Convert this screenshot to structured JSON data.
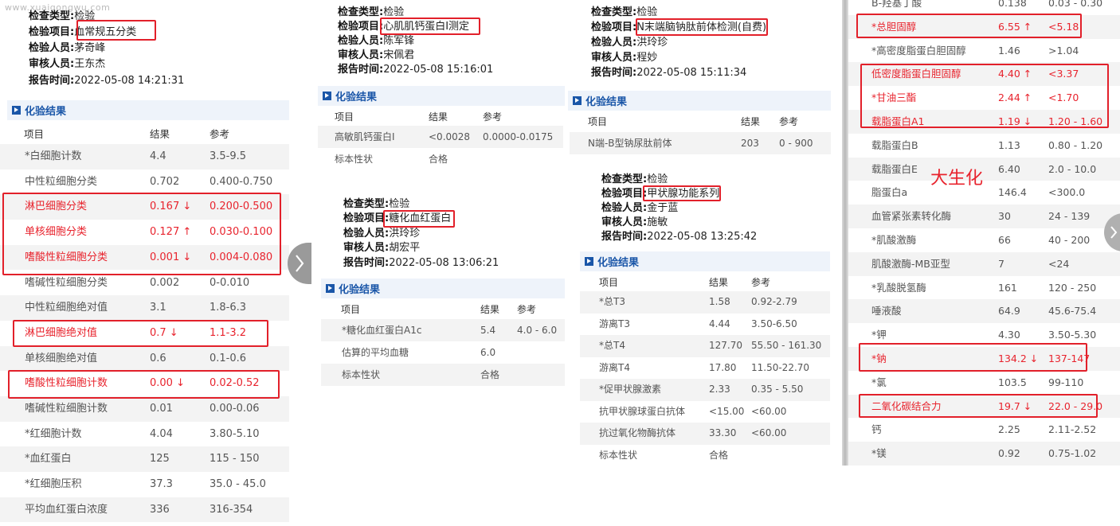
{
  "watermark": "www.xuaigongwu.com",
  "labels": {
    "type": "检查类型:",
    "item": "检验项目:",
    "person": "检验人员:",
    "reviewer": "审核人员:",
    "time": "报告时间:"
  },
  "section_title": "化验结果",
  "col": {
    "item": "项目",
    "result": "结果",
    "ref": "参考"
  },
  "p1": {
    "type": "检验",
    "item": "血常规五分类",
    "person": "茅奇峰",
    "reviewer": "王东杰",
    "time": "2022-05-08 14:21:31",
    "rows": [
      [
        "*白细胞计数",
        "4.4",
        "3.5-9.5"
      ],
      [
        "中性粒细胞分类",
        "0.702",
        "0.400-0.750"
      ],
      [
        "淋巴细胞分类",
        "0.167 ↓",
        "0.200-0.500"
      ],
      [
        "单核细胞分类",
        "0.127 ↑",
        "0.030-0.100"
      ],
      [
        "嗜酸性粒细胞分类",
        "0.001 ↓",
        "0.004-0.080"
      ],
      [
        "嗜碱性粒细胞分类",
        "0.002",
        "0-0.010"
      ],
      [
        "中性粒细胞绝对值",
        "3.1",
        "1.8-6.3"
      ],
      [
        "淋巴细胞绝对值",
        "0.7 ↓",
        "1.1-3.2"
      ],
      [
        "单核细胞绝对值",
        "0.6",
        "0.1-0.6"
      ],
      [
        "嗜酸性粒细胞计数",
        "0.00 ↓",
        "0.02-0.52"
      ],
      [
        "嗜碱性粒细胞计数",
        "0.01",
        "0.00-0.06"
      ],
      [
        "*红细胞计数",
        "4.04",
        "3.80-5.10"
      ],
      [
        "*血红蛋白",
        "125",
        "115 - 150"
      ],
      [
        "*红细胞压积",
        "37.3",
        "35.0 - 45.0"
      ],
      [
        "平均血红蛋白浓度",
        "336",
        "316-354"
      ]
    ]
  },
  "p2": {
    "type": "检验",
    "item": "心肌肌钙蛋白I测定",
    "person": "陈军锋",
    "reviewer": "宋佩君",
    "time": "2022-05-08 15:16:01",
    "rows": [
      [
        "高敏肌钙蛋白I",
        "<0.0028",
        "0.0000-0.0175"
      ],
      [
        "标本性状",
        "合格",
        ""
      ]
    ]
  },
  "p3": {
    "type": "检验",
    "item": "糖化血红蛋白",
    "person": "洪玲珍",
    "reviewer": "胡宏平",
    "time": "2022-05-08 13:06:21",
    "rows": [
      [
        "*糖化血红蛋白A1c",
        "5.4",
        "4.0 - 6.0"
      ],
      [
        "估算的平均血糖",
        "6.0",
        ""
      ],
      [
        "标本性状",
        "合格",
        ""
      ]
    ]
  },
  "p4": {
    "type": "检验",
    "item": "N末端脑钠肽前体检测(自费)",
    "person": "洪玲珍",
    "reviewer": "程妙",
    "time": "2022-05-08 15:11:34",
    "rows": [
      [
        "N端-B型钠尿肽前体",
        "203",
        "0 - 900"
      ]
    ]
  },
  "p5": {
    "type": "检验",
    "item": "甲状腺功能系列",
    "person": "金于蓝",
    "reviewer": "施敏",
    "time": "2022-05-08 13:25:42",
    "rows": [
      [
        "*总T3",
        "1.58",
        "0.92-2.79"
      ],
      [
        "游离T3",
        "4.44",
        "3.50-6.50"
      ],
      [
        "*总T4",
        "127.70",
        "55.50 - 161.30"
      ],
      [
        "游离T4",
        "17.80",
        "11.50-22.70"
      ],
      [
        "*促甲状腺激素",
        "2.33",
        "0.35 - 5.50"
      ],
      [
        "抗甲状腺球蛋白抗体",
        "<15.00",
        "<60.00"
      ],
      [
        "抗过氧化物酶抗体",
        "33.30",
        "<60.00"
      ],
      [
        "标本性状",
        "合格",
        ""
      ]
    ]
  },
  "p6": {
    "annotation": "大生化",
    "rows": [
      [
        "B-羟基丁酸",
        "0.138",
        "0.03 - 0.30"
      ],
      [
        "*总胆固醇",
        "6.55 ↑",
        "<5.18"
      ],
      [
        "*高密度脂蛋白胆固醇",
        "1.46",
        ">1.04"
      ],
      [
        "低密度脂蛋白胆固醇",
        "4.40 ↑",
        "<3.37"
      ],
      [
        "*甘油三酯",
        "2.44 ↑",
        "<1.70"
      ],
      [
        "载脂蛋白A1",
        "1.19 ↓",
        "1.20 - 1.60"
      ],
      [
        "载脂蛋白B",
        "1.13",
        "0.80 - 1.20"
      ],
      [
        "载脂蛋白E",
        "6.40",
        "2.0 - 10.0"
      ],
      [
        "脂蛋白a",
        "146.4",
        "<300.0"
      ],
      [
        "血管紧张素转化酶",
        "30",
        "24 - 139"
      ],
      [
        "*肌酸激酶",
        "66",
        "40 - 200"
      ],
      [
        "肌酸激酶-MB亚型",
        "7",
        "<24"
      ],
      [
        "*乳酸脱氢酶",
        "161",
        "120 - 250"
      ],
      [
        "唾液酸",
        "64.9",
        "45.6-75.4"
      ],
      [
        "*钾",
        "4.30",
        "3.50-5.30"
      ],
      [
        "*钠",
        "134.2 ↓",
        "137-147"
      ],
      [
        "*氯",
        "103.5",
        "99-110"
      ],
      [
        "二氧化碳结合力",
        "19.7 ↓",
        "22.0 - 29.0"
      ],
      [
        "钙",
        "2.25",
        "2.11-2.52"
      ],
      [
        "*镁",
        "0.92",
        "0.75-1.02"
      ]
    ]
  },
  "colors": {
    "accent": "#1a56a8",
    "highlight": "#e2202a",
    "abnormal": "#e8232d"
  }
}
